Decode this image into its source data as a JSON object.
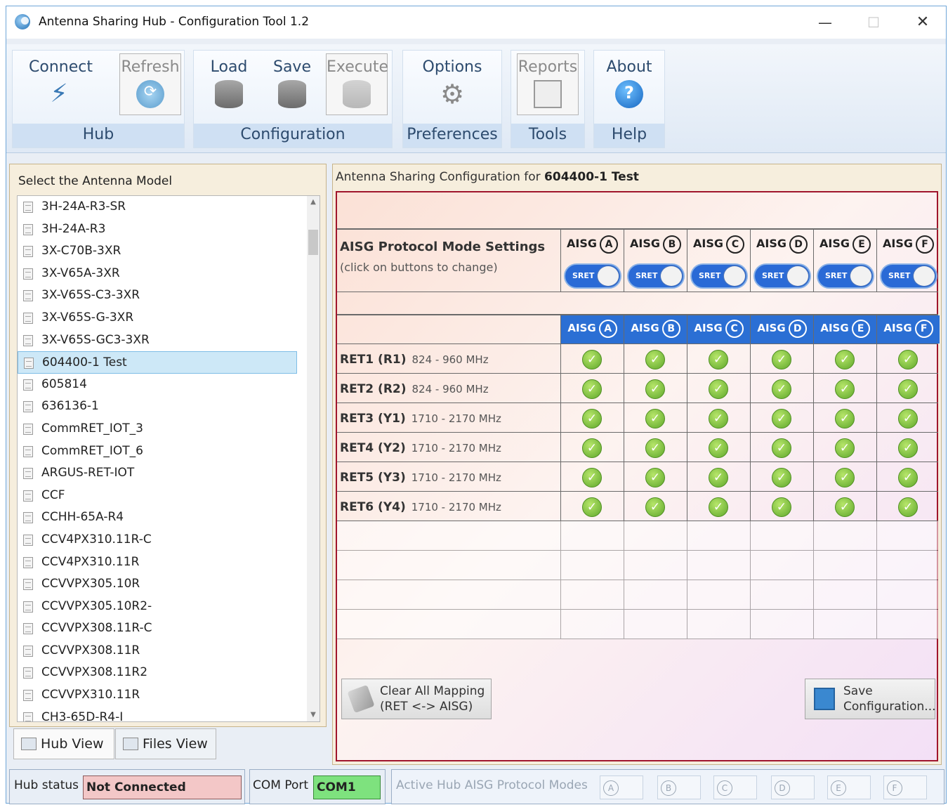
{
  "window": {
    "title": "Antenna Sharing Hub - Configuration Tool 1.2",
    "minimize": "—",
    "maximize": "☐",
    "close": "✕"
  },
  "ribbon": {
    "groups": [
      {
        "label": "Hub",
        "buttons": [
          {
            "label": "Connect",
            "icon": "plug-icon",
            "enabled": true
          },
          {
            "label": "Refresh",
            "icon": "refresh-icon",
            "enabled": false
          }
        ]
      },
      {
        "label": "Configuration",
        "buttons": [
          {
            "label": "Load",
            "icon": "database-icon",
            "enabled": true
          },
          {
            "label": "Save",
            "icon": "database-save-icon",
            "enabled": true
          },
          {
            "label": "Execute",
            "icon": "database-execute-icon",
            "enabled": false
          }
        ]
      },
      {
        "label": "Preferences",
        "buttons": [
          {
            "label": "Options",
            "icon": "gear-icon",
            "enabled": true
          }
        ]
      },
      {
        "label": "Tools",
        "buttons": [
          {
            "label": "Reports",
            "icon": "reports-icon",
            "enabled": false
          }
        ]
      },
      {
        "label": "Help",
        "buttons": [
          {
            "label": "About",
            "icon": "help-icon",
            "enabled": true
          }
        ]
      }
    ],
    "help_glyph": "?",
    "refresh_glyph": "⟳",
    "gear_glyph": "⚙",
    "plug_glyph": "⚡"
  },
  "left_panel": {
    "title": "Select the Antenna Model",
    "selected": "604400-1 Test",
    "items": [
      "3H-24A-R3-SR",
      "3H-24A-R3",
      "3X-C70B-3XR",
      "3X-V65A-3XR",
      "3X-V65S-C3-3XR",
      "3X-V65S-G-3XR",
      "3X-V65S-GC3-3XR",
      "604400-1 Test",
      "605814",
      "636136-1",
      "CommRET_IOT_3",
      "CommRET_IOT_6",
      "ARGUS-RET-IOT",
      "CCF",
      "CCHH-65A-R4",
      "CCV4PX310.11R-C",
      "CCV4PX310.11R",
      "CCVVPX305.10R",
      "CCVVPX305.10R2-",
      "CCVVPX308.11R-C",
      "CCVVPX308.11R",
      "CCVVPX308.11R2",
      "CCVVPX310.11R",
      "CH3-65D-R4-I"
    ],
    "tabs": {
      "hub_view": "Hub View",
      "files_view": "Files View"
    }
  },
  "right_panel": {
    "title_prefix": "Antenna Sharing Configuration for ",
    "title_model": "604400-1 Test",
    "mode_settings": {
      "label": "AISG Protocol Mode Settings",
      "hint": "(click on buttons to change)"
    },
    "aisg_prefix": "AISG",
    "ports": [
      "A",
      "B",
      "C",
      "D",
      "E",
      "F"
    ],
    "toggle_label": "SRET",
    "rets": [
      {
        "name": "RET1 (R1)",
        "freq": "824 - 960 MHz",
        "mapped": [
          true,
          true,
          true,
          true,
          true,
          true
        ]
      },
      {
        "name": "RET2 (R2)",
        "freq": "824 - 960 MHz",
        "mapped": [
          true,
          true,
          true,
          true,
          true,
          true
        ]
      },
      {
        "name": "RET3 (Y1)",
        "freq": "1710 - 2170 MHz",
        "mapped": [
          true,
          true,
          true,
          true,
          true,
          true
        ]
      },
      {
        "name": "RET4 (Y2)",
        "freq": "1710 - 2170 MHz",
        "mapped": [
          true,
          true,
          true,
          true,
          true,
          true
        ]
      },
      {
        "name": "RET5 (Y3)",
        "freq": "1710 - 2170 MHz",
        "mapped": [
          true,
          true,
          true,
          true,
          true,
          true
        ]
      },
      {
        "name": "RET6 (Y4)",
        "freq": "1710 - 2170 MHz",
        "mapped": [
          true,
          true,
          true,
          true,
          true,
          true
        ]
      }
    ],
    "empty_rows": 4,
    "check_glyph": "✓",
    "clear_button": {
      "line1": "Clear All Mapping",
      "line2": "(RET <-> AISG)"
    },
    "save_button": {
      "line1": "Save",
      "line2": "Configuration..."
    }
  },
  "status_bar": {
    "hub_status_label": "Hub status",
    "hub_status_value": "Not Connected",
    "com_port_label": "COM Port",
    "com_port_value": "COM1",
    "active_modes_label": "Active Hub AISG Protocol Modes",
    "modes": [
      "A",
      "B",
      "C",
      "D",
      "E",
      "F"
    ]
  },
  "colors": {
    "aisg_header_blue": "#2b6fd4",
    "not_connected": "#f3c7c7",
    "com_port_ok": "#7ee27e",
    "mapping_border": "#a0152c"
  }
}
